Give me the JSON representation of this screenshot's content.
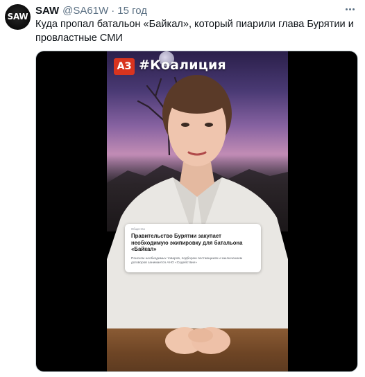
{
  "tweet": {
    "avatar_text": "SAW",
    "display_name": "SAW",
    "handle": "@SA61W",
    "separator": "·",
    "time": "15 год",
    "text": "Куда пропал батальон «Байкал», который пиарили глава Бурятии и провластные СМИ"
  },
  "video": {
    "logo": "АЗ",
    "hashtag": "#Коалиция",
    "card": {
      "meta": "Общество",
      "title": "Правительство Бурятии закупает необходимую экипировку для батальона «Байкал»",
      "description": "Поиском необходимых товаров, подбором поставщиков и заключением договоров занимается АНО «Содействие»"
    }
  },
  "icons": {
    "more": "more-horizontal-icon"
  },
  "colors": {
    "text_primary": "#0f1419",
    "text_secondary": "#5b7083",
    "media_background": "#000000",
    "logo_red": "#d9341f"
  }
}
